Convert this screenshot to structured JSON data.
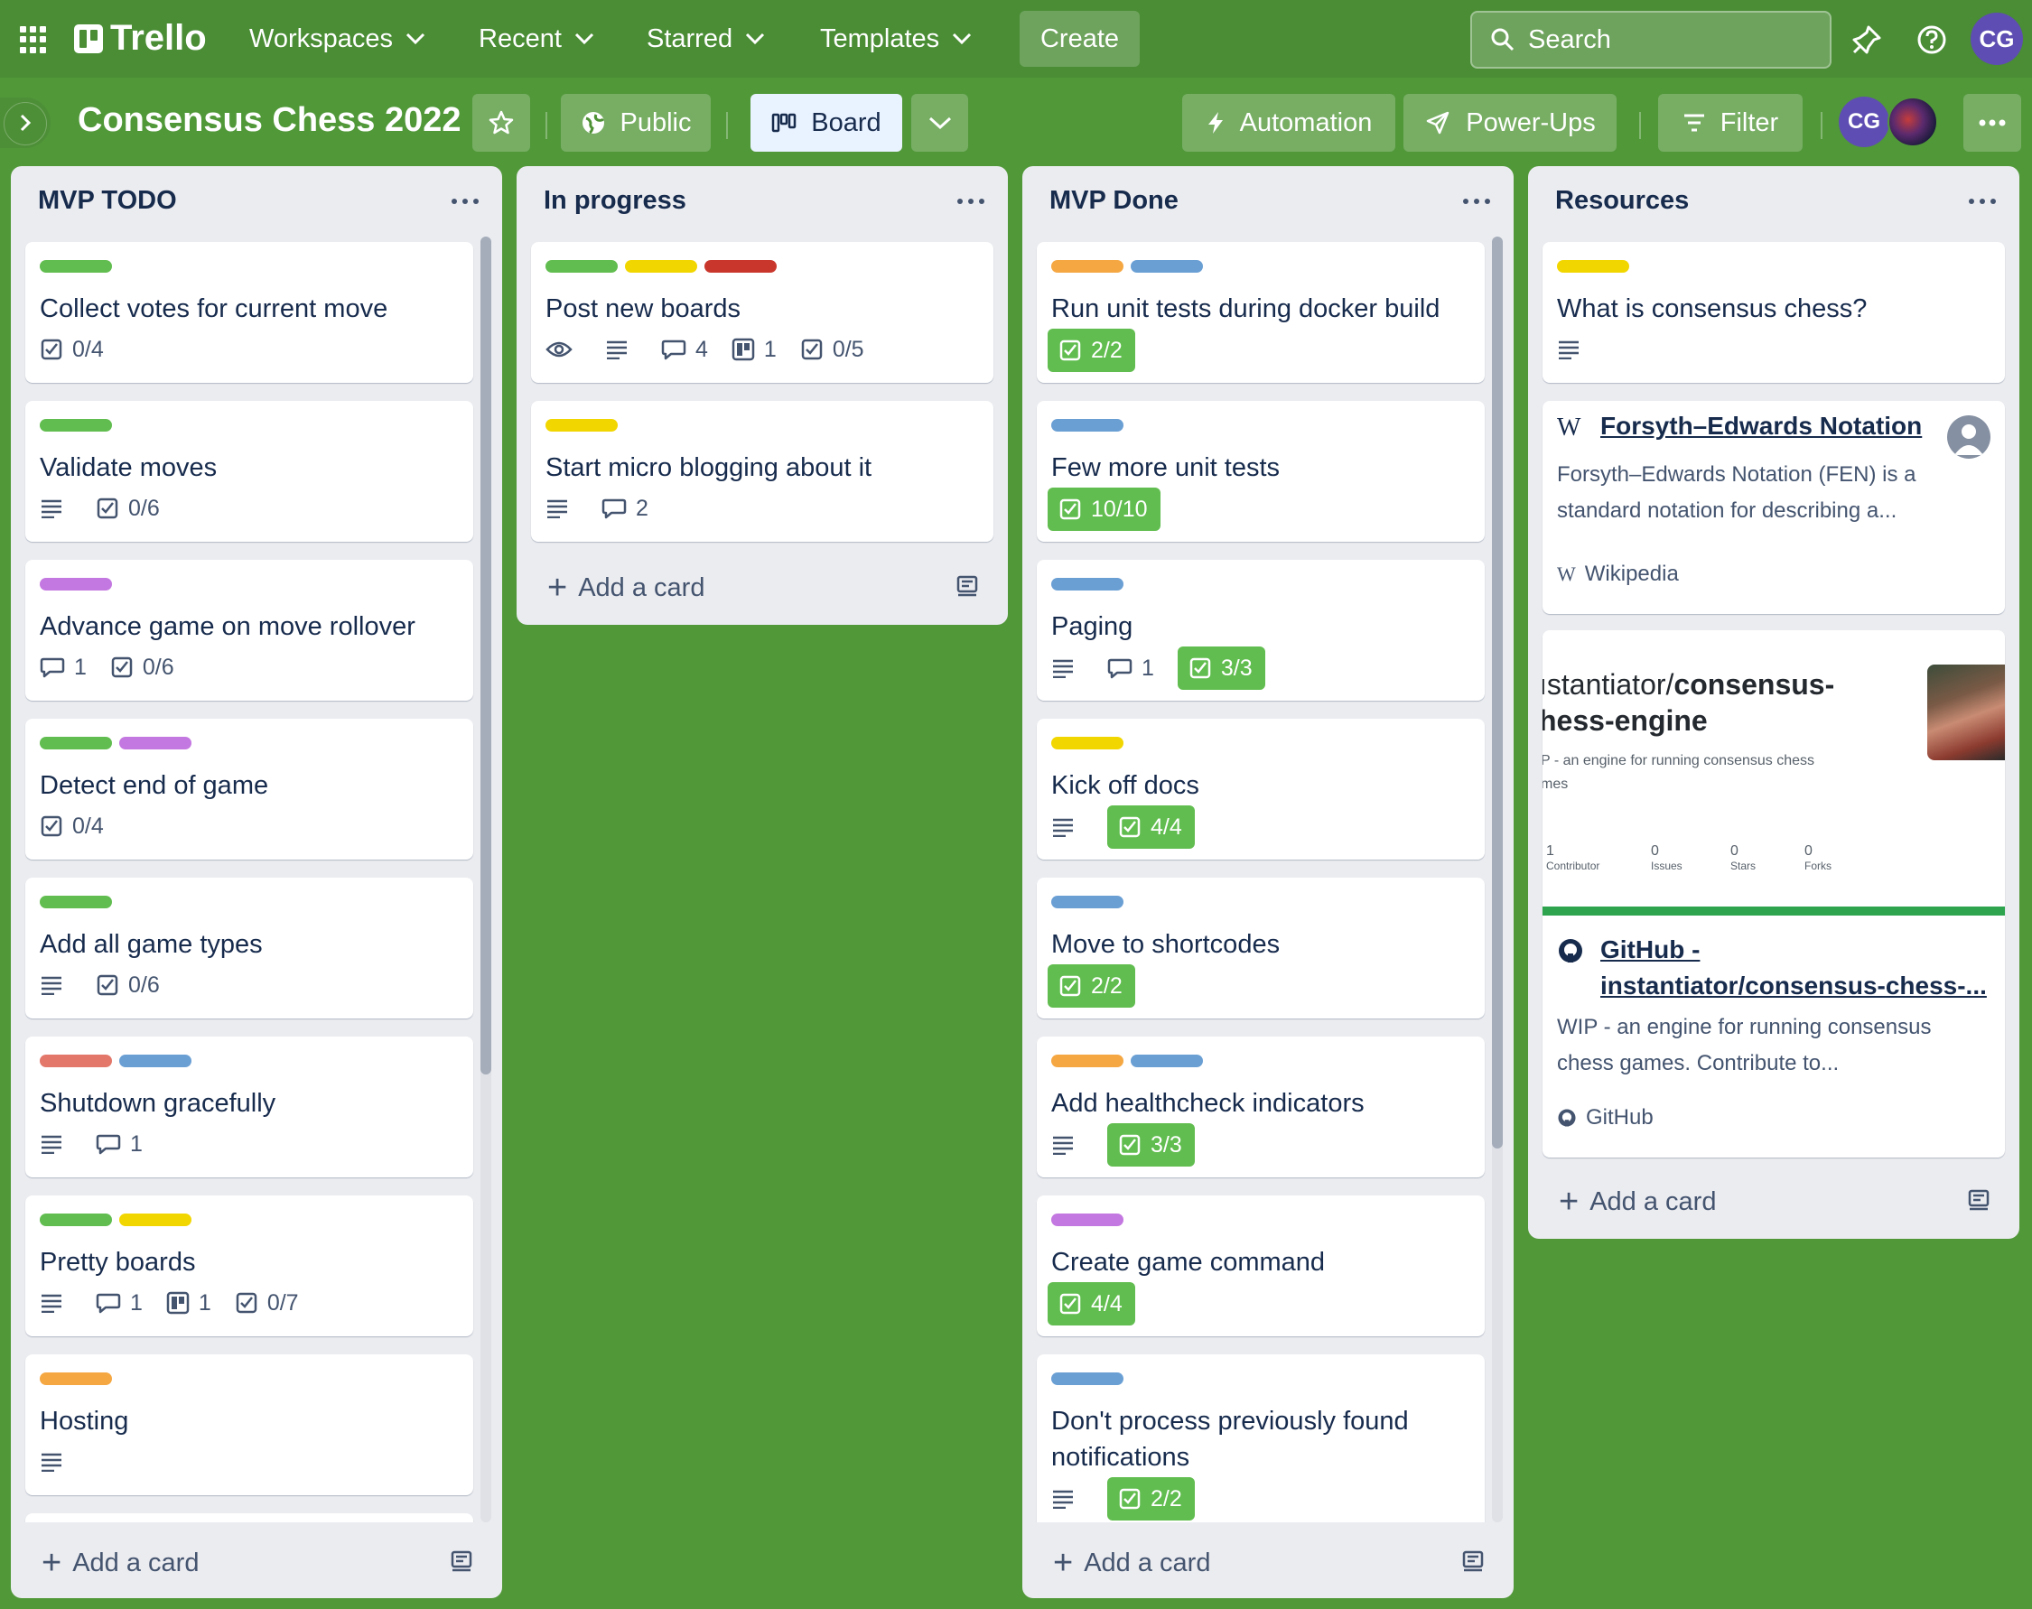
{
  "app": {
    "brand": "Trello"
  },
  "nav": {
    "workspaces": "Workspaces",
    "recent": "Recent",
    "starred": "Starred",
    "templates": "Templates",
    "create": "Create"
  },
  "search": {
    "label": "Search"
  },
  "user": {
    "initials": "CG"
  },
  "board": {
    "title": "Consensus Chess 2022",
    "visibility": "Public",
    "view": "Board",
    "automation": "Automation",
    "powerups": "Power-Ups",
    "filter": "Filter",
    "member_initials": "CG"
  },
  "colors": {
    "green": "#61bd4f",
    "yellow": "#f2d600",
    "red": "#c9372c",
    "salmon": "#e2776a",
    "blue": "#6a9fd4",
    "purple": "#c377e0",
    "orange": "#f5a742"
  },
  "lists": [
    {
      "title": "MVP TODO",
      "add_card": "Add a card",
      "cards": [
        {
          "title": "Collect votes for current move",
          "labels": [
            "green"
          ],
          "checklist": "0/4"
        },
        {
          "title": "Validate moves",
          "labels": [
            "green"
          ],
          "checklist": "0/6"
        },
        {
          "title": "Advance game on move rollover",
          "labels": [
            "purple"
          ],
          "comments": "1",
          "checklist": "0/6"
        },
        {
          "title": "Detect end of game",
          "labels": [
            "green",
            "purple"
          ],
          "checklist": "0/4"
        },
        {
          "title": "Add all game types",
          "labels": [
            "green"
          ],
          "checklist": "0/6"
        },
        {
          "title": "Shutdown gracefully",
          "labels": [
            "salmon",
            "blue"
          ],
          "comments": "1"
        },
        {
          "title": "Pretty boards",
          "labels": [
            "green",
            "yellow"
          ],
          "comments": "1",
          "attachments": "1",
          "checklist": "0/7"
        },
        {
          "title": "Hosting",
          "labels": [
            "orange"
          ]
        }
      ]
    },
    {
      "title": "In progress",
      "add_card": "Add a card",
      "cards": [
        {
          "title": "Post new boards",
          "labels": [
            "green",
            "yellow",
            "red"
          ],
          "comments": "4",
          "attachments": "1",
          "checklist": "0/5"
        },
        {
          "title": "Start micro blogging about it",
          "labels": [
            "yellow"
          ],
          "comments": "2"
        }
      ]
    },
    {
      "title": "MVP Done",
      "add_card": "Add a card",
      "cards": [
        {
          "title": "Run unit tests during docker build",
          "labels": [
            "orange",
            "blue"
          ],
          "checklist": "2/2"
        },
        {
          "title": "Few more unit tests",
          "labels": [
            "blue"
          ],
          "checklist": "10/10"
        },
        {
          "title": "Paging",
          "labels": [
            "blue"
          ],
          "comments": "1",
          "checklist": "3/3"
        },
        {
          "title": "Kick off docs",
          "labels": [
            "yellow"
          ],
          "checklist": "4/4"
        },
        {
          "title": "Move to shortcodes",
          "labels": [
            "blue"
          ],
          "checklist": "2/2"
        },
        {
          "title": "Add healthcheck indicators",
          "labels": [
            "orange",
            "blue"
          ],
          "checklist": "3/3"
        },
        {
          "title": "Create game command",
          "labels": [
            "purple"
          ],
          "checklist": "4/4"
        },
        {
          "title": "Don't process previously found notifications",
          "labels": [
            "blue"
          ],
          "checklist": "2/2"
        }
      ]
    },
    {
      "title": "Resources",
      "add_card": "Add a card",
      "cards": [
        {
          "title": "What is consensus chess?",
          "labels": [
            "yellow"
          ]
        },
        {
          "link_title": "Forsyth–Edwards Notation",
          "description": "Forsyth–Edwards Notation (FEN) is a standard notation for describing a...",
          "source": "Wikipedia",
          "source_icon": "W"
        },
        {
          "preview": {
            "repo_prefix": "ıstantiator/",
            "repo_name_line1": "consensus-",
            "repo_name_line2": "hess-engine",
            "desc_line1": "P - an engine for running consensus chess",
            "desc_line2": "mes",
            "stats": [
              {
                "value": "1",
                "label": "Contributor"
              },
              {
                "value": "0",
                "label": "Issues"
              },
              {
                "value": "0",
                "label": "Stars"
              },
              {
                "value": "0",
                "label": "Forks"
              }
            ]
          },
          "link_title_line1": "GitHub -",
          "link_title_line2": "instantiator/consensus-chess-...",
          "description_line1": "WIP - an engine for running consensus",
          "description_line2": "chess games. Contribute to...",
          "source": "GitHub"
        }
      ]
    }
  ]
}
